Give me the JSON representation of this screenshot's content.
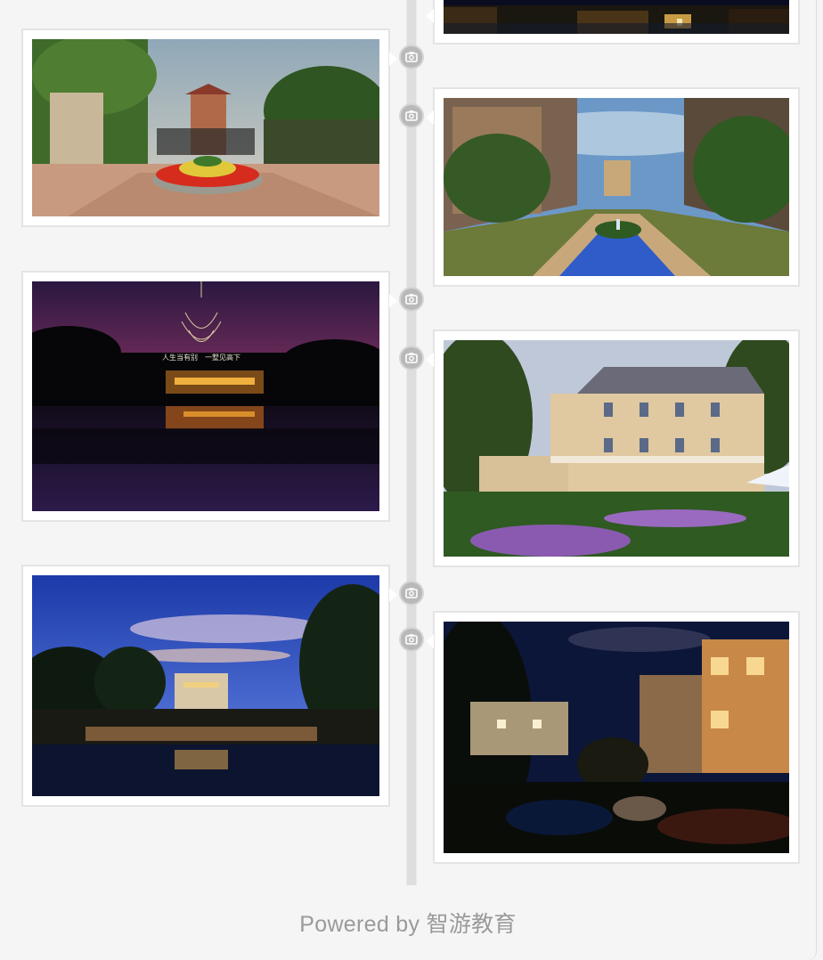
{
  "footer": {
    "text": "Powered by 智游教育"
  },
  "posts": [
    {
      "side": "right",
      "photo_description": "night waterfront villa",
      "palette": [
        "#050816",
        "#2b2318",
        "#c97a2c"
      ]
    },
    {
      "side": "left",
      "photo_description": "garden entrance with flowers and gate tower"
    },
    {
      "side": "right",
      "photo_description": "courtyard fountain between villas"
    },
    {
      "side": "left",
      "photo_description": "night lake with chandelier",
      "overlay_text": "人生当有别　一墅见高下"
    },
    {
      "side": "right",
      "photo_description": "european villa with garden"
    },
    {
      "side": "left",
      "photo_description": "villa reflected at dusk"
    },
    {
      "side": "right",
      "photo_description": "night villa with stream"
    }
  ],
  "colors": {
    "rail": "#dedede",
    "marker": "#b9b9b9",
    "card_border": "#e4e4e4",
    "footer_text": "#9a9a9a"
  }
}
